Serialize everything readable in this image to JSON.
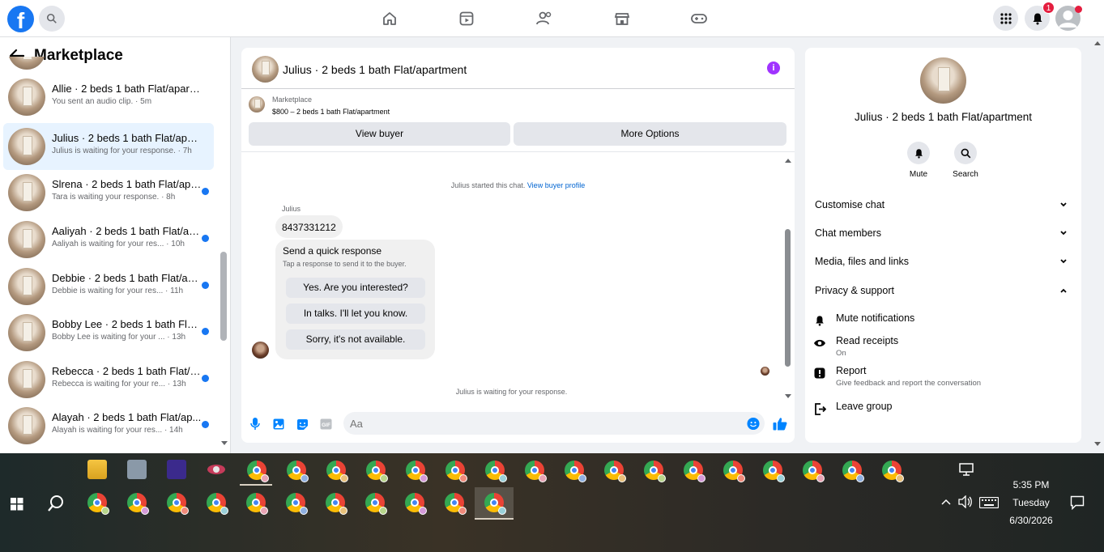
{
  "topbar": {
    "logo_letter": "f",
    "notification_count": "1"
  },
  "left_panel": {
    "title": "Marketplace",
    "conversations": [
      {
        "name": "Allie · 2 beds 1 bath Flat/apartm...",
        "subtitle": "You sent an audio clip. · 5m",
        "unread": false,
        "active": false
      },
      {
        "name": "Julius · 2 beds 1 bath Flat/apart...",
        "subtitle": "Julius is waiting for your response. · 7h",
        "unread": false,
        "active": true
      },
      {
        "name": "Slrena · 2 beds 1 bath Flat/apa...",
        "subtitle": "Tara is waiting your response. · 8h",
        "unread": true,
        "active": false
      },
      {
        "name": "Aaliyah · 2 beds 1 bath Flat/ap...",
        "subtitle": "Aaliyah is waiting for your res... · 10h",
        "unread": true,
        "active": false
      },
      {
        "name": "Debbie · 2 beds 1 bath Flat/ap...",
        "subtitle": "Debbie is waiting for your res... · 11h",
        "unread": true,
        "active": false
      },
      {
        "name": "Bobby Lee · 2 beds 1 bath Flat...",
        "subtitle": "Bobby Lee is waiting for your ... · 13h",
        "unread": true,
        "active": false
      },
      {
        "name": "Rebecca · 2 beds 1 bath Flat/a...",
        "subtitle": "Rebecca is waiting for your re... · 13h",
        "unread": true,
        "active": false
      },
      {
        "name": "Alayah · 2 beds 1 bath Flat/ap...",
        "subtitle": "Alayah is waiting for your res... · 14h",
        "unread": true,
        "active": false
      }
    ]
  },
  "chat": {
    "title": "Julius · 2 beds 1 bath Flat/apartment",
    "listing_source": "Marketplace",
    "listing": "$800 – 2 beds 1 bath Flat/apartment",
    "view_buyer": "View buyer",
    "more_options": "More Options",
    "started_text": "Julius started this chat.",
    "view_profile": "View buyer profile",
    "sender": "Julius",
    "message": "8437331212",
    "quick_title": "Send a quick response",
    "quick_sub": "Tap a response to send it to the buyer.",
    "quick_replies": [
      "Yes. Are you interested?",
      "In talks. I'll let you know.",
      "Sorry, it's not available."
    ],
    "waiting_text": "Julius is waiting for your response.",
    "input_placeholder": "Aa"
  },
  "right_panel": {
    "title": "Julius · 2 beds 1 bath Flat/apartment",
    "mute": "Mute",
    "search": "Search",
    "sections": [
      "Customise chat",
      "Chat members",
      "Media, files and links",
      "Privacy & support"
    ],
    "mute_notifications": "Mute notifications",
    "read_receipts": "Read receipts",
    "read_receipts_state": "On",
    "report": "Report",
    "report_sub": "Give feedback and report the conversation",
    "leave_group": "Leave group"
  },
  "taskbar": {
    "time": "5:35 PM",
    "day": "Tuesday",
    "date": "6/30/2026"
  },
  "colors": {
    "accent": "#1877f2",
    "active_row": "#e7f3ff",
    "info": "#a033ff"
  }
}
